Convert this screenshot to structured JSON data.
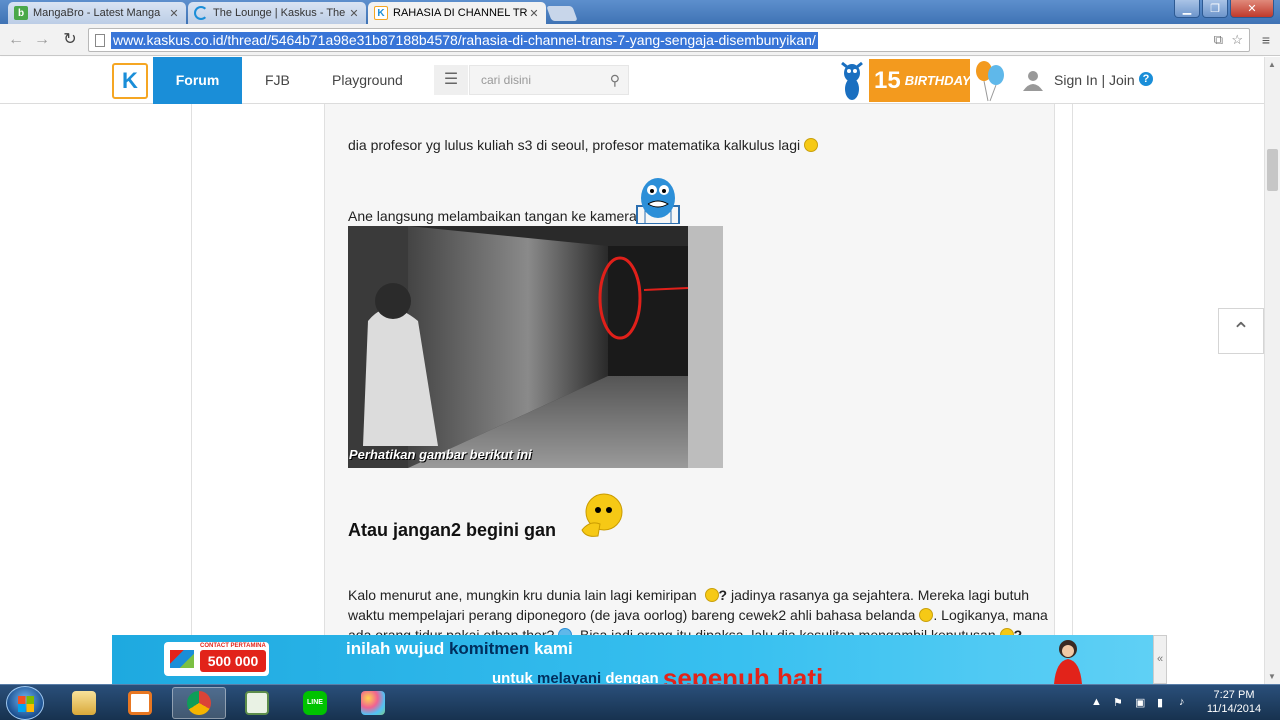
{
  "browser": {
    "tabs": [
      {
        "title": "MangaBro - Latest Manga",
        "favicon": "b",
        "favicon_color": "#4aa84a"
      },
      {
        "title": "The Lounge | Kaskus - The",
        "favicon": "",
        "favicon_color": "#1a8ed8"
      },
      {
        "title": "RAHASIA DI CHANNEL TR",
        "favicon": "K",
        "favicon_color": "#1a8ed8"
      }
    ],
    "url": "www.kaskus.co.id/thread/5464b71a98e31b87188b4578/rahasia-di-channel-trans-7-yang-sengaja-disembunyikan/"
  },
  "header": {
    "logo": "K",
    "nav_active": "Forum",
    "nav_items": [
      "FJB",
      "Playground"
    ],
    "search_placeholder": "cari disini",
    "birthday_num": "15",
    "birthday_word": "BIRTHDAY",
    "signin": "Sign In",
    "separator": "|",
    "join": "Join"
  },
  "post": {
    "line1": "dia profesor yg lulus kuliah s3 di seoul, profesor matematika kalkulus lagi",
    "line2": "Ane langsung melambaikan tangan ke kamera",
    "image_caption": "Perhatikan gambar berikut ini",
    "heading": "Atau jangan2 begini gan",
    "para_a1": "Kalo menurut ane, mungkin kru dunia lain lagi kemiripan",
    "para_a2": "jadinya rasanya ga sejahtera. Mereka lagi butuh",
    "para_b1": "waktu mempelajari perang diponegoro (de java oorlog) bareng cewek2 ahli bahasa belanda",
    "para_b2": ". Logikanya, mana",
    "para_c1": "ada orang tidur pakai ethan ther?",
    "para_c2": ". Bisa jadi orang itu dipaksa, lalu dia kesulitan mengambil keputusan",
    "qmark": "?"
  },
  "ad": {
    "logo_label": "CONTACT PERTAMINA",
    "logo_number": "500 000",
    "line1_a": "inilah wujud ",
    "line1_b": "komitmen",
    "line1_c": " kami",
    "line2_a": "untuk ",
    "line2_b": "melayani",
    "line2_c": " dengan ",
    "line2_d": "sepenuh hati",
    "collapse": "«"
  },
  "taskbar": {
    "time": "7:27 PM",
    "date": "11/14/2014"
  }
}
